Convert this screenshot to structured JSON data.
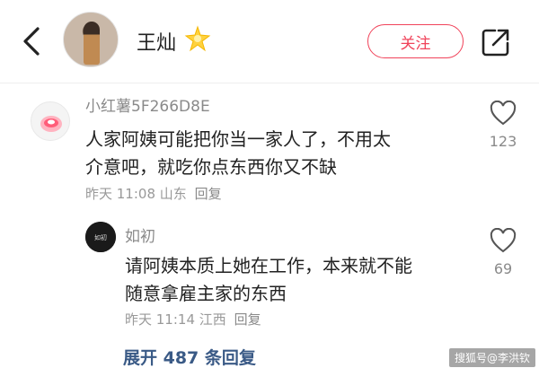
{
  "header": {
    "username": "王灿",
    "follow_label": "关注"
  },
  "comments": [
    {
      "author": "小红薯5F266D8E",
      "text_line1": "人家阿姨可能把你当一家人了，不用太",
      "text_line2": "介意吧，就吃你点东西你又不缺",
      "time": "昨天 11:08",
      "location": "山东",
      "reply_label": "回复",
      "likes": "123"
    },
    {
      "author": "如初",
      "text_line1": "请阿姨本质上她在工作，本来就不能",
      "text_line2": "随意拿雇主家的东西",
      "time": "昨天 11:14",
      "location": "江西",
      "reply_label": "回复",
      "likes": "69"
    }
  ],
  "expand_label": "展开 487 条回复",
  "watermark": "搜狐号@李洪钦",
  "icons": {
    "back": "chevron-left-icon",
    "star": "star-badge-icon",
    "share": "share-icon",
    "like": "heart-icon"
  },
  "colors": {
    "accent": "#f0435a",
    "link": "#3a5a86",
    "secondary_text": "#8a8a8a"
  }
}
